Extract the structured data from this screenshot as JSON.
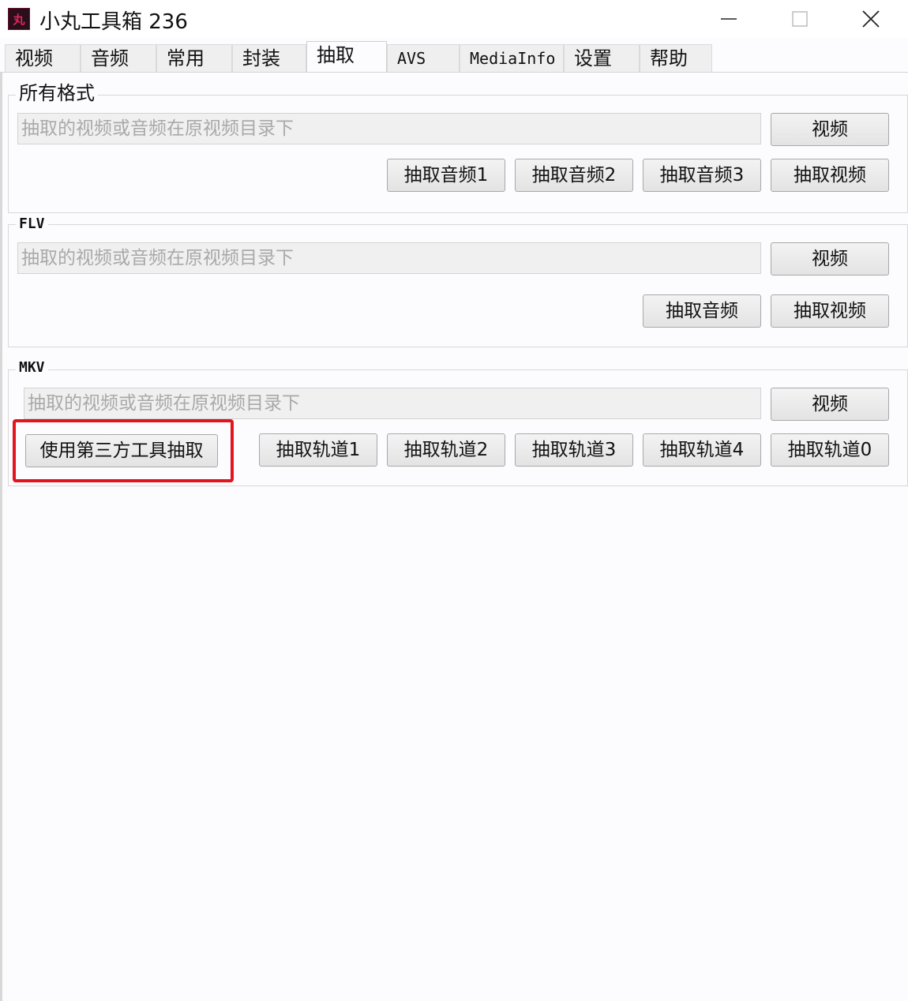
{
  "window": {
    "icon_glyph": "丸",
    "title": "小丸工具箱 236",
    "controls": [
      "minimize-icon",
      "maximize-icon",
      "close-icon"
    ]
  },
  "tabs": [
    {
      "label": "视频"
    },
    {
      "label": "音频"
    },
    {
      "label": "常用"
    },
    {
      "label": "封装"
    },
    {
      "label": "抽取",
      "active": true
    },
    {
      "label": "AVS"
    },
    {
      "label": "MediaInfo"
    },
    {
      "label": "设置"
    },
    {
      "label": "帮助"
    }
  ],
  "groups": {
    "all_formats": {
      "title": "所有格式",
      "placeholder": "抽取的视频或音频在原视频目录下",
      "video_button": "视频",
      "buttons": [
        "抽取音频1",
        "抽取音频2",
        "抽取音频3",
        "抽取视频"
      ]
    },
    "flv": {
      "title": "FLV",
      "placeholder": "抽取的视频或音频在原视频目录下",
      "video_button": "视频",
      "buttons": [
        "抽取音频",
        "抽取视频"
      ]
    },
    "mkv": {
      "title": "MKV",
      "placeholder": "抽取的视频或音频在原视频目录下",
      "video_button": "视频",
      "third_party_button": "使用第三方工具抽取",
      "buttons": [
        "抽取轨道1",
        "抽取轨道2",
        "抽取轨道3",
        "抽取轨道4",
        "抽取轨道0"
      ]
    }
  },
  "colors": {
    "highlight": "#e4141f",
    "icon_bg": "#2a0f1a",
    "icon_fg": "#e0245e"
  }
}
